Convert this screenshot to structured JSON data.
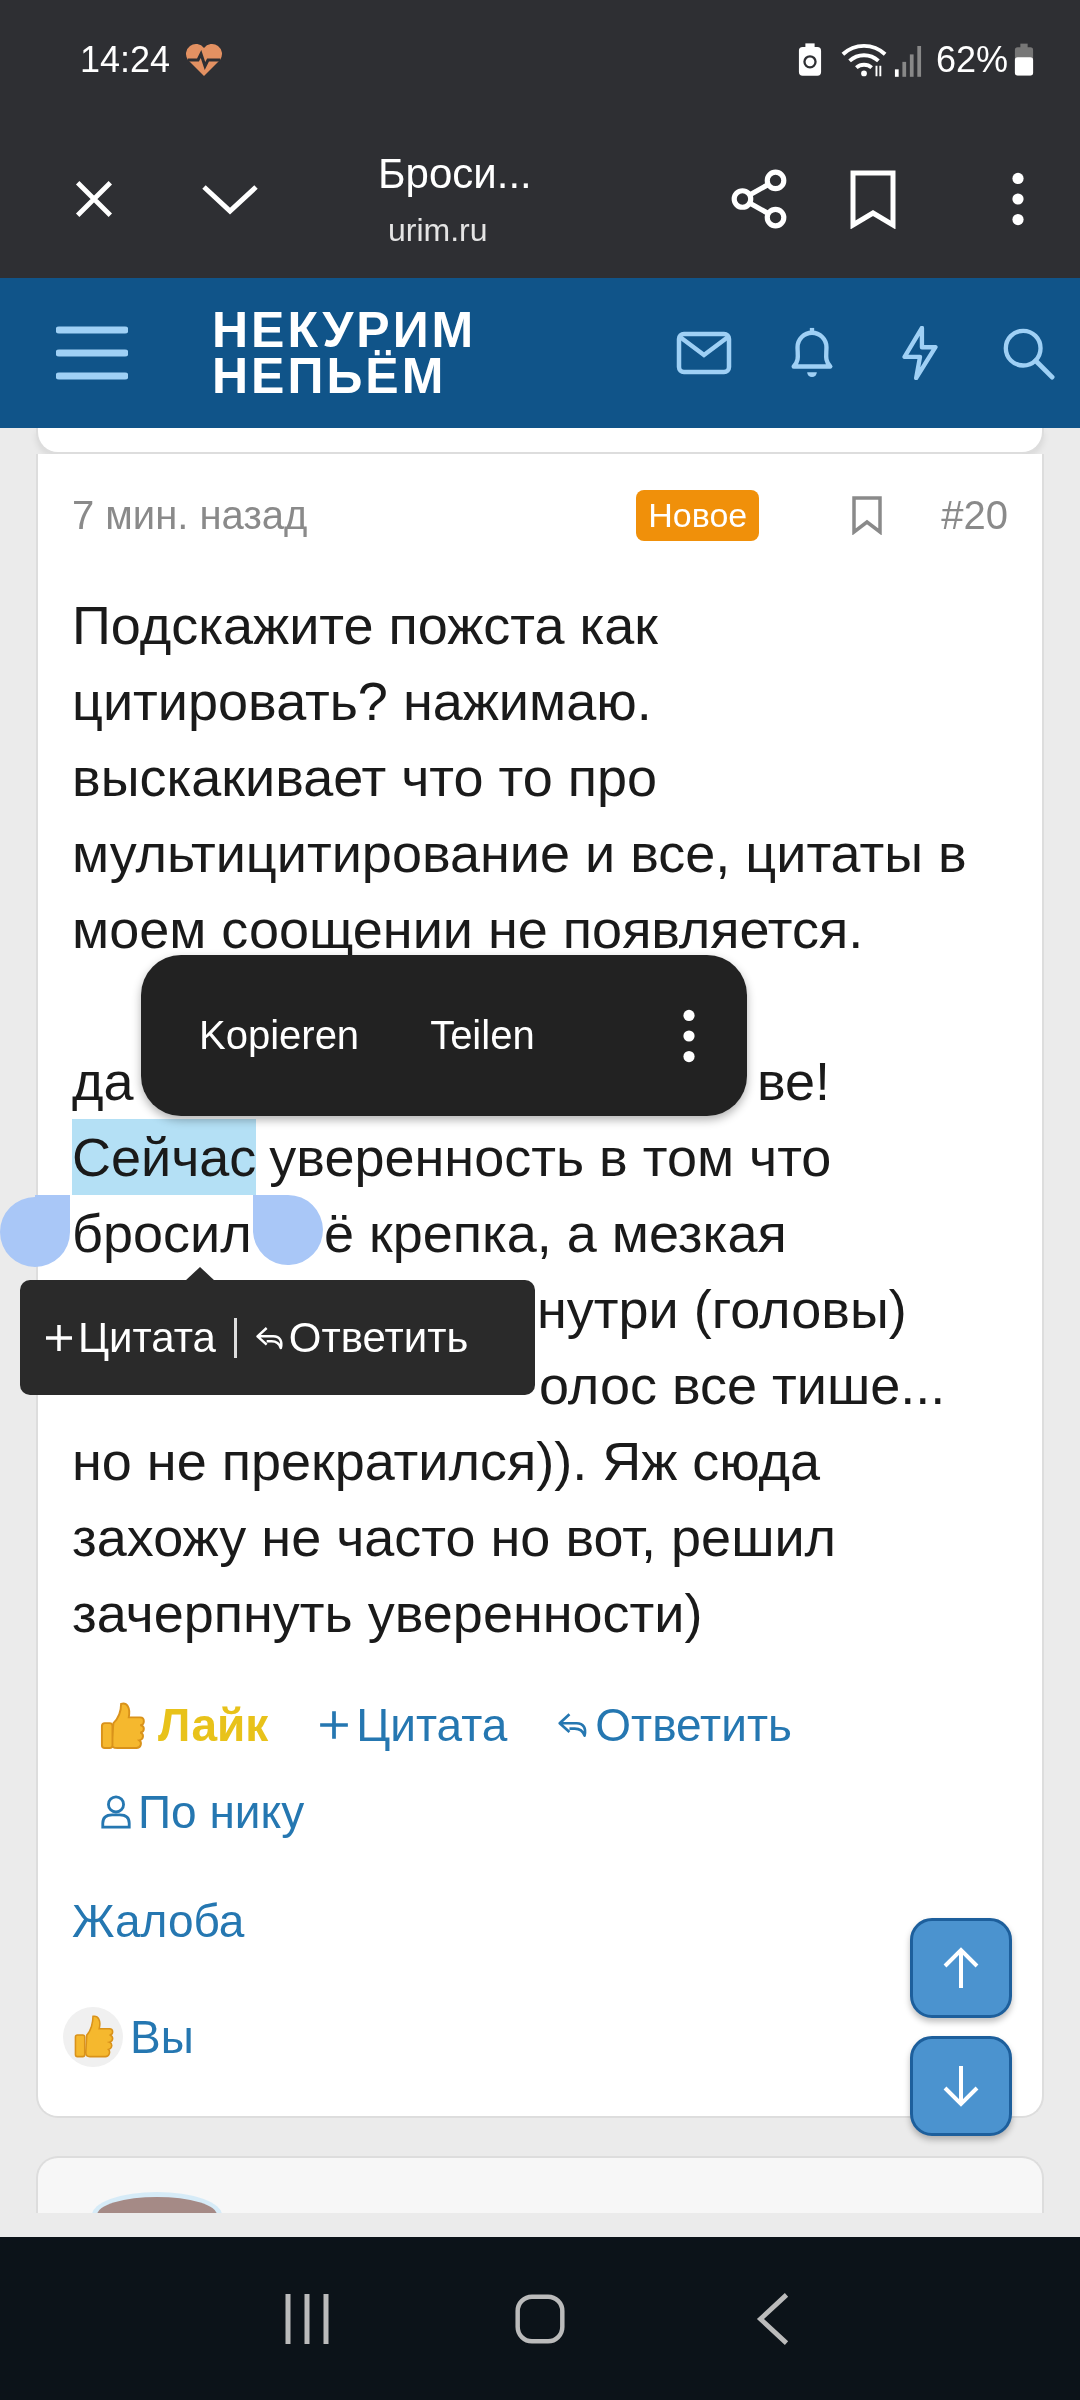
{
  "status_bar": {
    "time": "14:24",
    "battery": "62%"
  },
  "browser_bar": {
    "title": "Броси...",
    "url": "urim.ru"
  },
  "site_header": {
    "logo_lines": [
      "НЕКУРИМ",
      "НЕПЬЁМ"
    ]
  },
  "post": {
    "time": "7 мин. назад",
    "badge": "Новое",
    "number": "#20",
    "paragraph_1": [
      "Подскажите пожста как",
      "цитировать? нажимаю.",
      "выскакивает что то про",
      "мультицитирование и все, цитаты в",
      "моем соощении не появляется."
    ],
    "lines": [
      {
        "segments": [
          {
            "text": "да",
            "selected": false
          },
          {
            "text": "ве!",
            "selected": false
          }
        ]
      },
      {
        "segments": [
          {
            "text": "Сейчас",
            "selected": true
          },
          {
            "text": "уверенность в том что",
            "selected": false
          }
        ]
      },
      {
        "segments": [
          {
            "text": "бросил",
            "selected": false
          },
          {
            "text": "ё крепка, а мезкая",
            "selected": false
          }
        ]
      },
      {
        "segments": [
          {
            "text": "нутри (головы)",
            "selected": false
          }
        ]
      },
      {
        "segments": [
          {
            "text": "олос все тише...",
            "selected": false
          }
        ]
      },
      {
        "segments": [
          {
            "text": "но не прекратился)). Яж сюда",
            "selected": false
          }
        ]
      },
      {
        "segments": [
          {
            "text": "захожу не часто но вот, решил",
            "selected": false
          }
        ]
      },
      {
        "segments": [
          {
            "text": "зачерпнуть уверенности)",
            "selected": false
          }
        ]
      }
    ],
    "actions": [
      {
        "kind": "like",
        "label": "Лайк"
      },
      {
        "kind": "quote",
        "label": "Цитата"
      },
      {
        "kind": "reply",
        "label": "Ответить"
      },
      {
        "kind": "nick",
        "label": "По нику"
      }
    ],
    "report": "Жалоба",
    "reactions": {
      "label": "Вы"
    }
  },
  "selection_menu": {
    "items": [
      "Kopieren",
      "Teilen"
    ]
  },
  "quote_tooltip": {
    "items": [
      {
        "kind": "quote",
        "label": "Цитата"
      },
      {
        "kind": "reply",
        "label": "Ответить"
      }
    ]
  }
}
